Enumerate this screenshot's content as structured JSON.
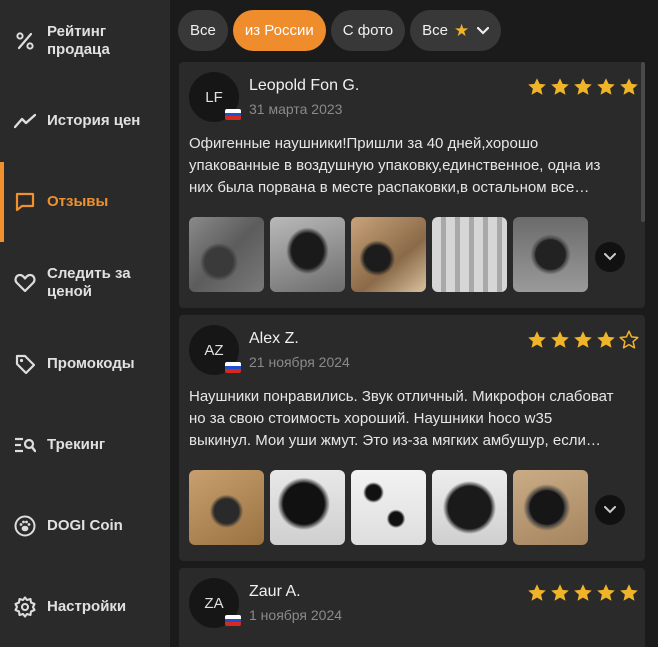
{
  "sidebar": {
    "items": [
      {
        "label": "Рейтинг\nпродаца",
        "icon": "percent-icon"
      },
      {
        "label": "История цен",
        "icon": "trend-line-icon"
      },
      {
        "label": "Отзывы",
        "icon": "chat-bubble-icon"
      },
      {
        "label": "Следить за\nценой",
        "icon": "heart-icon"
      },
      {
        "label": "Промокоды",
        "icon": "tag-icon"
      },
      {
        "label": "Трекинг",
        "icon": "search-list-icon"
      },
      {
        "label": "DOGI Coin",
        "icon": "paw-icon"
      },
      {
        "label": "Настройки",
        "icon": "gear-icon"
      }
    ],
    "active_index": 2,
    "accent": "#f0912e"
  },
  "filters": {
    "all": "Все",
    "from_russia": "из России",
    "with_photo": "С фото",
    "rating": "Все"
  },
  "reviews": [
    {
      "initials": "LF",
      "author": "Leopold Fon G.",
      "date": "31 марта 2023",
      "rating": 5,
      "text_lines": [
        "Офигенные наушники!Пришли за 40 дней,хорошо",
        "упакованные в воздушную упаковку,единственное, одна из",
        "них была порвана в месте распаковки,в остальном все…"
      ]
    },
    {
      "initials": "AZ",
      "author": "Alex Z.",
      "date": "21 ноября 2024",
      "rating": 4,
      "text_lines": [
        "Наушники понравились. Звук отличный. Микрофон слабоват",
        "но за свою стоимость хороший. Наушники hoco w35",
        "выкинул. Мои уши жмут. Это из-за мягких амбушур, если…"
      ]
    },
    {
      "initials": "ZA",
      "author": "Zaur A.",
      "date": "1 ноября 2024",
      "rating": 5,
      "text_lines": []
    }
  ],
  "colors": {
    "star": "#f0b429",
    "active_chip": "#ef8c2c"
  }
}
